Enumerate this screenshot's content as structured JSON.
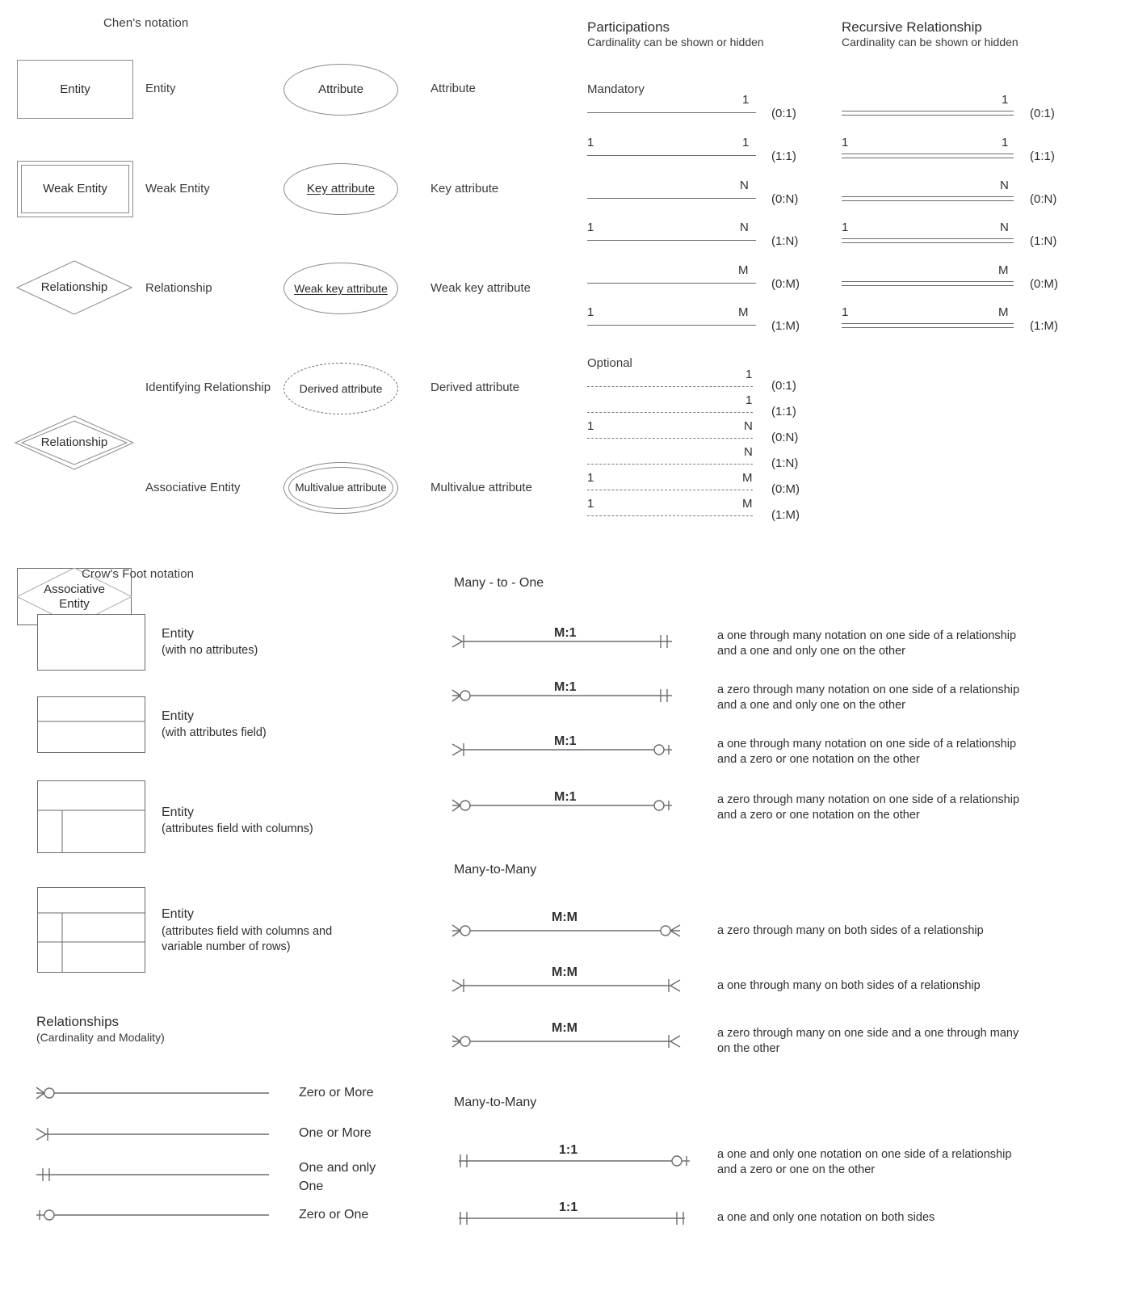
{
  "chen": {
    "title": "Chen's notation",
    "shapes": [
      {
        "shape_text": "Entity",
        "label": "Entity",
        "kind": "rect"
      },
      {
        "shape_text": "Weak Entity",
        "label": "Weak Entity",
        "kind": "double-rect"
      },
      {
        "shape_text": "Relationship",
        "label": "Relationship",
        "kind": "diamond"
      },
      {
        "shape_text": "Relationship",
        "label": "Identifying Relationship",
        "kind": "double-diamond"
      },
      {
        "shape_text": "Associative Entity",
        "label": "Associative Entity",
        "kind": "diamond-in-rect"
      }
    ],
    "attributes": [
      {
        "shape_text": "Attribute",
        "label": "Attribute",
        "kind": "ellipse"
      },
      {
        "shape_text": "Key attribute",
        "label": "Key attribute",
        "kind": "ellipse-underline"
      },
      {
        "shape_text": "Weak key attribute",
        "label": "Weak key attribute",
        "kind": "ellipse-dashed-underline"
      },
      {
        "shape_text": "Derived attribute",
        "label": "Derived attribute",
        "kind": "ellipse-dashed"
      },
      {
        "shape_text": "Multivalue attribute",
        "label": "Multivalue attribute",
        "kind": "double-ellipse"
      }
    ]
  },
  "participations": {
    "title": "Participations",
    "subtitle": "Cardinality can be shown or hidden",
    "mandatory_label": "Mandatory",
    "optional_label": "Optional",
    "mandatory_rows": [
      {
        "left": "",
        "right": "1",
        "card": "(0:1)"
      },
      {
        "left": "1",
        "right": "1",
        "card": "(1:1)"
      },
      {
        "left": "",
        "right": "N",
        "card": "(0:N)"
      },
      {
        "left": "1",
        "right": "N",
        "card": "(1:N)"
      },
      {
        "left": "",
        "right": "M",
        "card": "(0:M)"
      },
      {
        "left": "1",
        "right": "M",
        "card": "(1:M)"
      }
    ],
    "optional_rows": [
      {
        "left": "",
        "right": "1",
        "card": "(0:1)"
      },
      {
        "left": "",
        "right": "1",
        "card": "(1:1)"
      },
      {
        "left": "1",
        "right": "N",
        "card": "(0:N)"
      },
      {
        "left": "",
        "right": "N",
        "card": "(1:N)"
      },
      {
        "left": "1",
        "right": "M",
        "card": "(0:M)"
      },
      {
        "left": "1",
        "right": "M",
        "card": "(1:M)"
      }
    ]
  },
  "recursive": {
    "title": "Recursive Relationship",
    "subtitle": "Cardinality can be shown or hidden",
    "rows": [
      {
        "left": "",
        "right": "1",
        "card": "(0:1)"
      },
      {
        "left": "1",
        "right": "1",
        "card": "(1:1)"
      },
      {
        "left": "",
        "right": "N",
        "card": "(0:N)"
      },
      {
        "left": "1",
        "right": "N",
        "card": "(1:N)"
      },
      {
        "left": "",
        "right": "M",
        "card": "(0:M)"
      },
      {
        "left": "1",
        "right": "M",
        "card": "(1:M)"
      }
    ]
  },
  "crowsfoot": {
    "title": "Crow's Foot notation",
    "entities": [
      {
        "label": "Entity",
        "sub": "(with no attributes)",
        "kind": "plain"
      },
      {
        "label": "Entity",
        "sub": "(with attributes field)",
        "kind": "header-body"
      },
      {
        "label": "Entity",
        "sub": "(attributes field with columns)",
        "kind": "header-cols"
      },
      {
        "label": "Entity",
        "sub": "(attributes field with columns and\nvariable number of rows)",
        "kind": "header-cols-rows"
      }
    ],
    "relationships_title": "Relationships",
    "relationships_sub": "(Cardinality and Modality)",
    "symbols": [
      {
        "label": "Zero or More",
        "end": "crow-circle"
      },
      {
        "label": "One or More",
        "end": "crow-tick"
      },
      {
        "label": "One and only\nOne",
        "end": "double-tick"
      },
      {
        "label": "Zero or One",
        "end": "tick-circle"
      }
    ]
  },
  "many_to_one": {
    "title": "Many - to - One",
    "rows": [
      {
        "ratio": "M:1",
        "left": "crow-tick",
        "right": "double-tick",
        "desc": "a one through many notation on one side of a relationship\nand a one and only one on the other"
      },
      {
        "ratio": "M:1",
        "left": "crow-circle",
        "right": "double-tick",
        "desc": "a zero through many notation on one side of a relationship\nand a one and only one on the other"
      },
      {
        "ratio": "M:1",
        "left": "crow-tick",
        "right": "circle-tick",
        "desc": "a one through many notation on one side of a relationship\nand a zero or one notation on the other"
      },
      {
        "ratio": "M:1",
        "left": "crow-circle",
        "right": "circle-tick",
        "desc": "a zero through many notation on one side of a relationship\nand a zero or one notation on the other"
      }
    ]
  },
  "many_to_many": {
    "title": "Many-to-Many",
    "rows": [
      {
        "ratio": "M:M",
        "left": "crow-circle",
        "right": "circle-crow",
        "desc": "a zero through many on both sides of a relationship"
      },
      {
        "ratio": "M:M",
        "left": "crow-tick",
        "right": "crow-right",
        "desc": "a one through many on both sides of a relationship"
      },
      {
        "ratio": "M:M",
        "left": "crow-circle",
        "right": "crow-right",
        "desc": "a zero through many on one side and a one through many\non the other"
      }
    ]
  },
  "one_to_one": {
    "title": "Many-to-Many",
    "rows": [
      {
        "ratio": "1:1",
        "left": "double-tick",
        "right": "circle-tick",
        "desc": "a one and only one notation on one side of a relationship\nand a zero or one on the other"
      },
      {
        "ratio": "1:1",
        "left": "double-tick",
        "right": "double-tick",
        "desc": "a one and only one notation on both sides"
      }
    ]
  }
}
